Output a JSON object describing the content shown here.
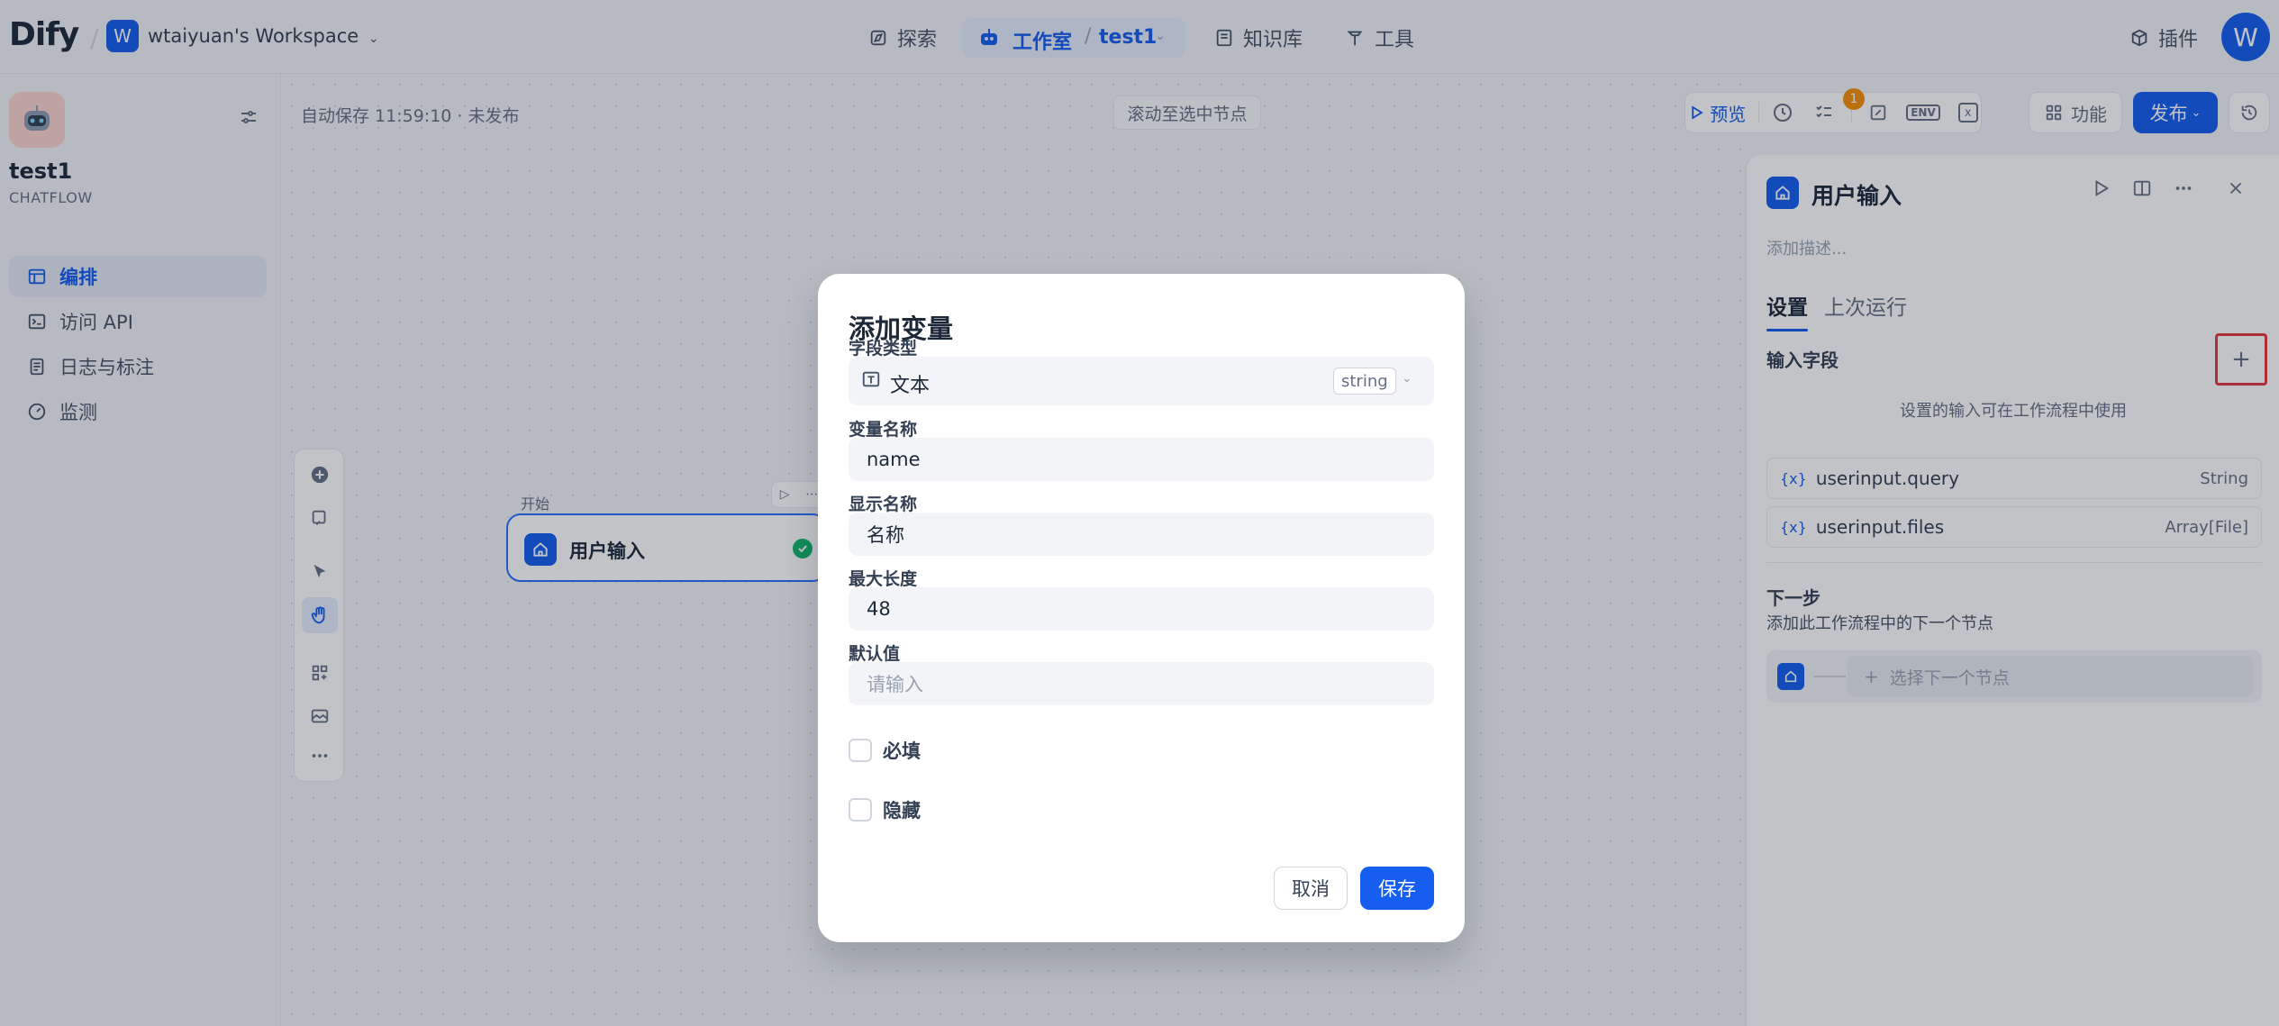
{
  "brand": {
    "logo": "Dify"
  },
  "workspace": {
    "initial": "W",
    "name": "wtaiyuan's Workspace"
  },
  "nav": {
    "explore": "探索",
    "studio": "工作室",
    "app": "test1",
    "knowledge": "知识库",
    "tools": "工具",
    "plugins": "插件"
  },
  "user": {
    "initial": "W"
  },
  "sidebar": {
    "app_name": "test1",
    "app_type": "CHATFLOW",
    "items": [
      {
        "label": "编排",
        "icon": "layout-icon",
        "active": true
      },
      {
        "label": "访问 API",
        "icon": "terminal-icon",
        "active": false
      },
      {
        "label": "日志与标注",
        "icon": "file-list-icon",
        "active": false
      },
      {
        "label": "监测",
        "icon": "gauge-icon",
        "active": false
      }
    ]
  },
  "canvas": {
    "autosave": "自动保存 11:59:10 · 未发布",
    "scroll_to_selected": "滚动至选中节点",
    "preview": "预览",
    "checklist_badge": "1",
    "env_label": "ENV",
    "features": "功能",
    "publish": "发布"
  },
  "node": {
    "section_label": "开始",
    "title": "用户输入"
  },
  "panel": {
    "title": "用户输入",
    "description_placeholder": "添加描述...",
    "tabs": [
      "设置",
      "上次运行"
    ],
    "input_fields_label": "输入字段",
    "add_button": "+",
    "hint": "设置的输入可在工作流程中使用",
    "variables": [
      {
        "brace": "{x}",
        "name": "userinput.query",
        "type": "String"
      },
      {
        "brace": "{x}",
        "name": "userinput.files",
        "type": "Array[File]"
      }
    ],
    "next_step_title": "下一步",
    "next_step_desc": "添加此工作流程中的下一个节点",
    "select_next_node": "选择下一个节点"
  },
  "modal": {
    "title": "添加变量",
    "field_type_label": "字段类型",
    "field_type_value": "文本",
    "field_type_badge": "string",
    "var_name_label": "变量名称",
    "var_name_value": "name",
    "display_name_label": "显示名称",
    "display_name_value": "名称",
    "max_length_label": "最大长度",
    "max_length_value": "48",
    "default_label": "默认值",
    "default_placeholder": "请输入",
    "required_label": "必填",
    "required_checked": false,
    "hidden_label": "隐藏",
    "hidden_checked": false,
    "cancel": "取消",
    "save": "保存"
  },
  "colors": {
    "primary": "#155eef",
    "highlight_box": "#e5383b",
    "success": "#12b76a",
    "badge": "#f79009"
  }
}
